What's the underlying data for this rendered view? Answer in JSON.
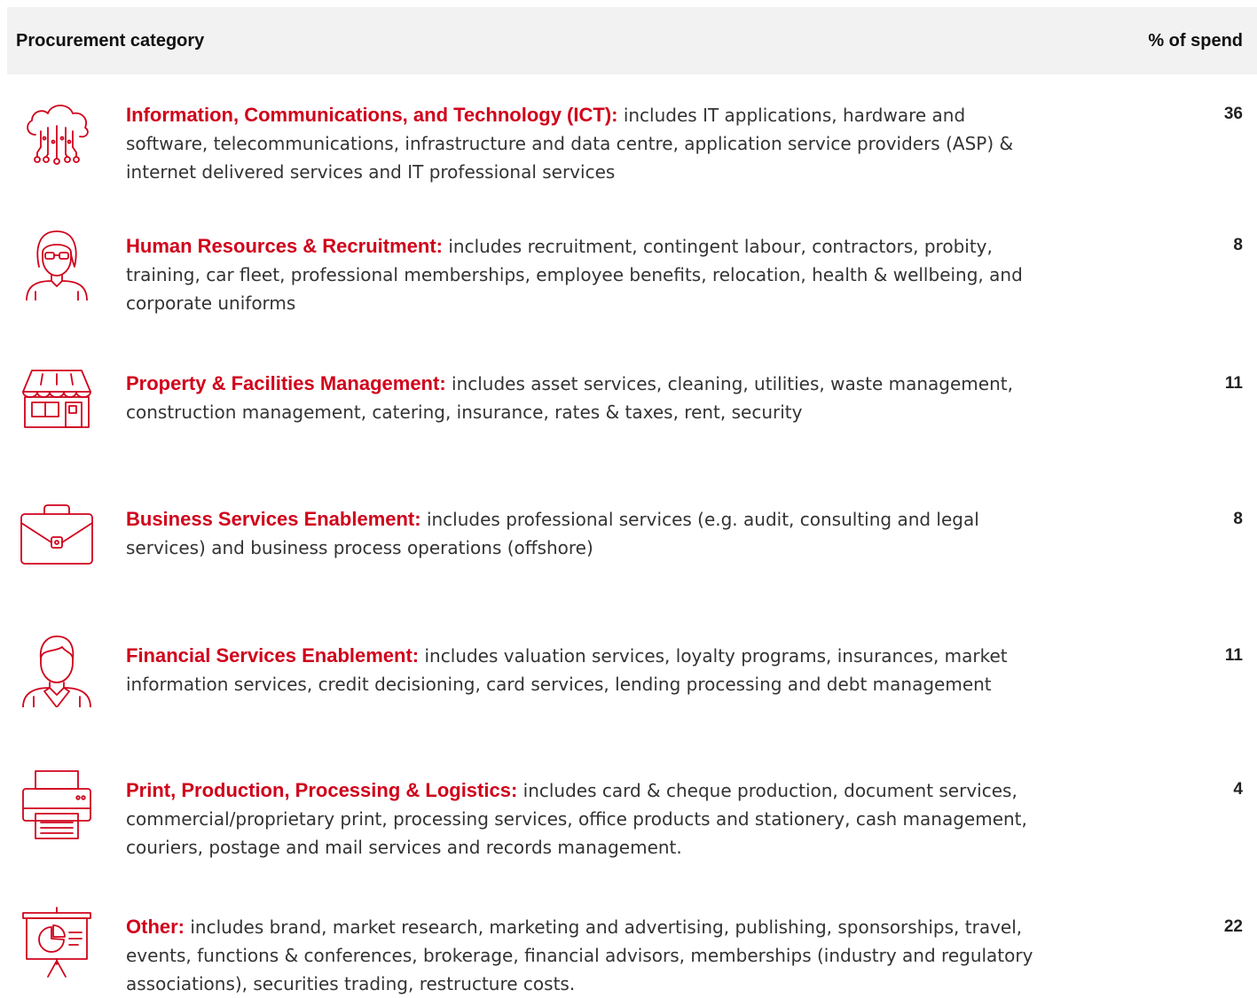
{
  "header": {
    "category_label": "Procurement category",
    "spend_label": "% of spend"
  },
  "accent_color": "#d0021b",
  "rows": [
    {
      "icon": "cloud-circuit-icon",
      "category": "Information, Communications, and Technology (ICT):",
      "description": " includes IT applications, hardware and software, telecommunications, infrastructure and data centre, application service providers (ASP) & internet delivered services and IT professional services",
      "percent": "36"
    },
    {
      "icon": "woman-with-glasses-icon",
      "category": "Human Resources & Recruitment:",
      "description": " includes recruitment, contingent labour, contractors, probity, training, car fleet, professional memberships, employee benefits, relocation, health & wellbeing, and corporate uniforms",
      "percent": "8"
    },
    {
      "icon": "storefront-icon",
      "category": "Property & Facilities Management:",
      "description": " includes asset services, cleaning, utilities, waste management, construction management, catering, insurance, rates & taxes, rent, security",
      "percent": "11"
    },
    {
      "icon": "briefcase-icon",
      "category": "Business Services Enablement:",
      "description": " includes professional services (e.g. audit, consulting and legal services) and business process operations (offshore)",
      "percent": "8"
    },
    {
      "icon": "businessman-icon",
      "category": "Financial Services Enablement:",
      "description": " includes valuation services, loyalty programs, insurances, market information services, credit decisioning, card services, lending processing and debt management",
      "percent": "11"
    },
    {
      "icon": "printer-icon",
      "category": "Print, Production, Processing & Logistics:",
      "description": " includes card & cheque production, document services, commercial/proprietary print, processing services, office products and stationery, cash management, couriers, postage and mail services and records management.",
      "percent": "4"
    },
    {
      "icon": "presentation-board-icon",
      "category": "Other:",
      "description": " includes brand, market research, marketing and advertising, publishing, sponsorships, travel, events, functions & conferences, brokerage, financial advisors, memberships (industry and regulatory associations), securities trading, restructure costs.",
      "percent": "22"
    }
  ]
}
